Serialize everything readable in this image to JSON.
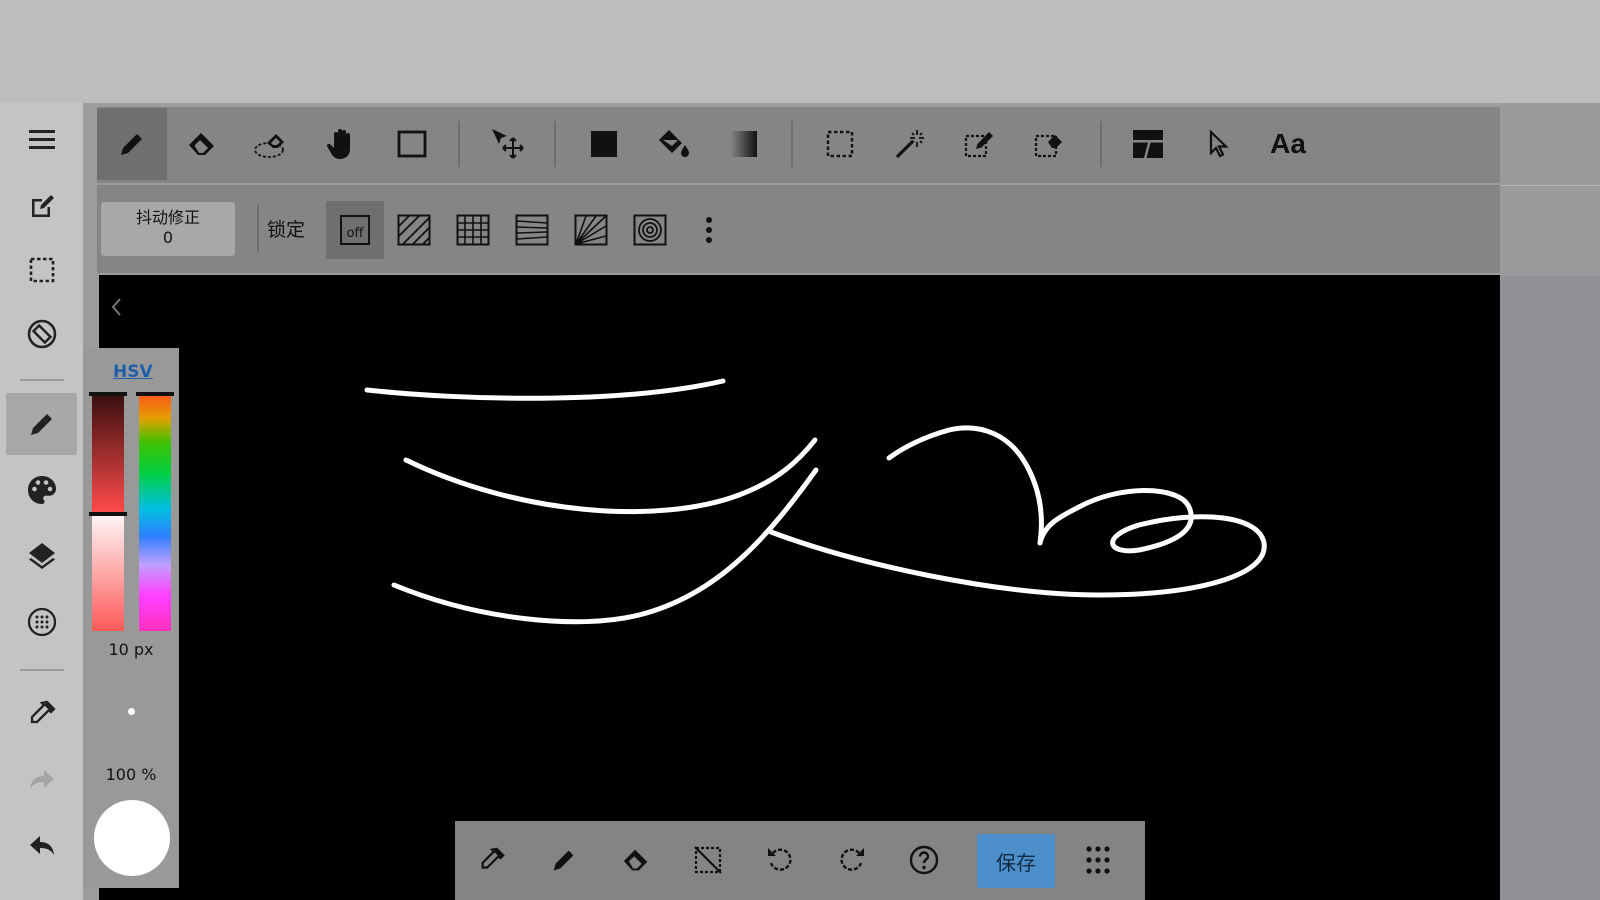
{
  "toolbar": {
    "tools": [
      {
        "icon": "pencil-icon",
        "active": true
      },
      {
        "icon": "eraser-icon"
      },
      {
        "icon": "blur-eraser-icon"
      },
      {
        "icon": "hand-icon"
      },
      {
        "icon": "rectangle-shape-icon"
      },
      {
        "icon": "move-icon"
      },
      {
        "icon": "fill-rect-icon"
      },
      {
        "icon": "bucket-icon"
      },
      {
        "icon": "gradient-icon"
      },
      {
        "icon": "select-rect-icon"
      },
      {
        "icon": "magic-wand-icon"
      },
      {
        "icon": "select-pen-icon"
      },
      {
        "icon": "select-eraser-icon"
      },
      {
        "icon": "frame-divide-icon"
      },
      {
        "icon": "pointer-icon"
      }
    ],
    "text_tool_label": "Aa"
  },
  "subtoolbar": {
    "stabilizer_label": "抖动修正",
    "stabilizer_value": "0",
    "lock_label": "锁定",
    "lock_off_label": "off"
  },
  "color_panel": {
    "mode_label": "HSV",
    "brush_size": "10 px",
    "opacity": "100 %",
    "current_color": "#ffffff"
  },
  "bottom_bar": {
    "save_label": "保存"
  },
  "colors": {
    "accent": "#4d8fcb",
    "toolbar": "#858585",
    "canvas": "#000000",
    "stroke": "#ffffff"
  }
}
